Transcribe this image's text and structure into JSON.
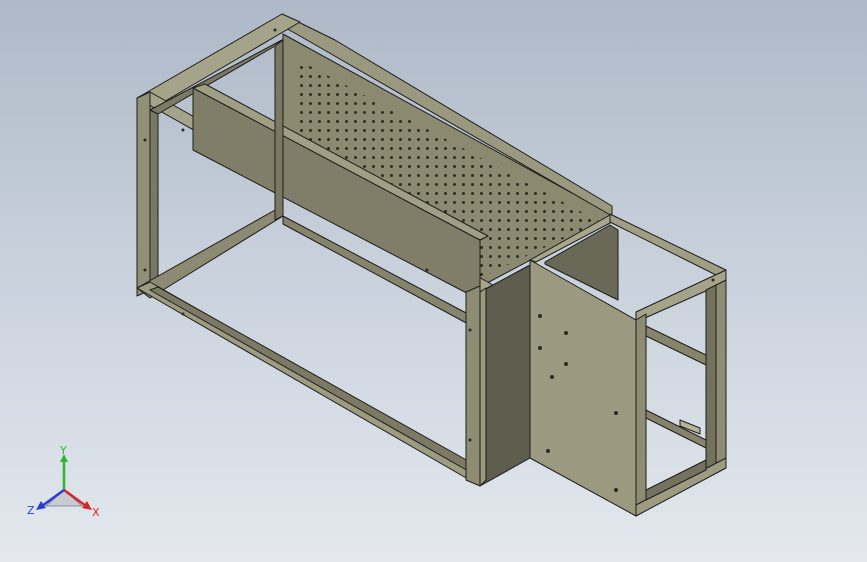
{
  "viewport": {
    "background_top": "#aeb9c8",
    "background_bottom": "#e4e8ee",
    "model_color": "#8e8c72",
    "model_shadow": "#6e6c58",
    "model_light": "#a5a38a",
    "edge_color": "#1e1e1a"
  },
  "triad": {
    "x_label": "X",
    "y_label": "Y",
    "z_label": "Z",
    "x_color": "#d6262a",
    "y_color": "#2eb832",
    "z_color": "#2a3ed6"
  }
}
